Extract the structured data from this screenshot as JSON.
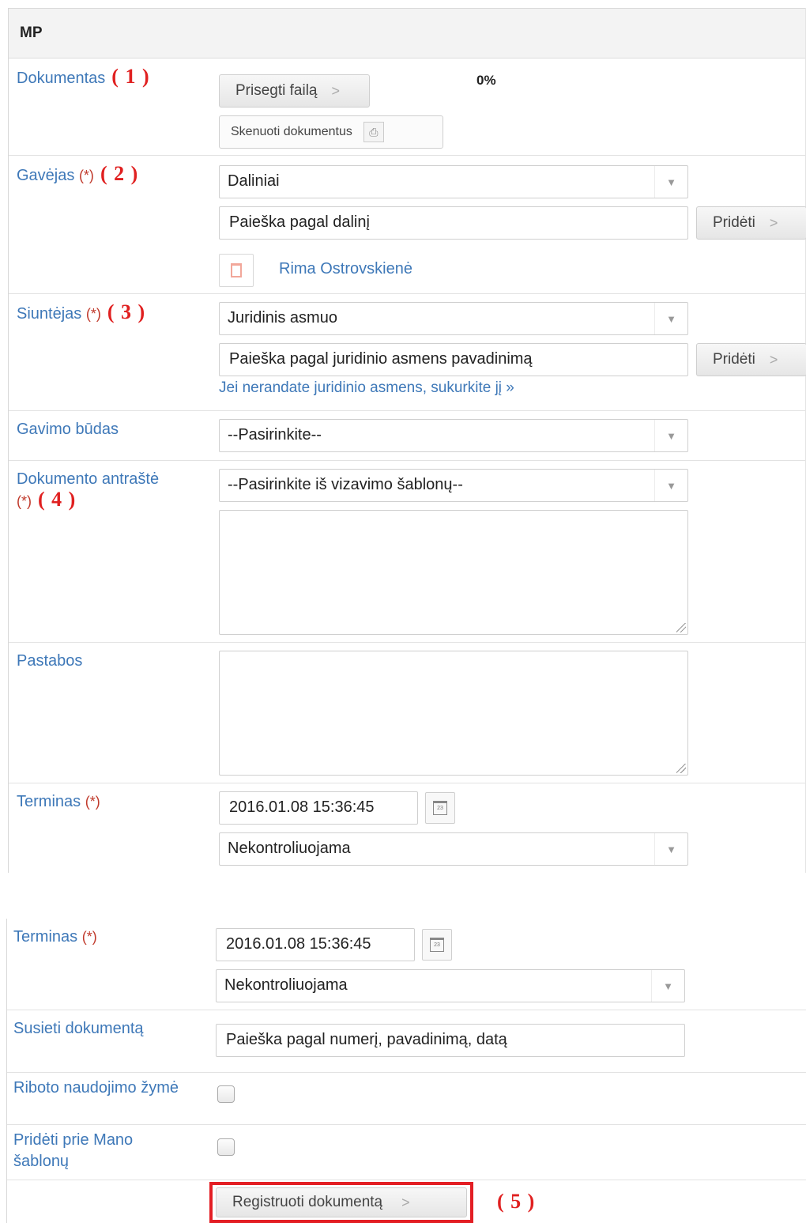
{
  "panel_title": "MP",
  "annotations": {
    "a1": "( 1 )",
    "a2": "( 2 )",
    "a3": "( 3 )",
    "a4": "( 4 )",
    "a5": "( 5 )"
  },
  "required_mark": "(*)",
  "dokumentas": {
    "label": "Dokumentas",
    "attach_button": "Prisegti failą",
    "scan_button": "Skenuoti dokumentus",
    "progress": "0%"
  },
  "gavejas": {
    "label": "Gavėjas",
    "type_select": "Daliniai",
    "search_value": "Paieška pagal dalinį",
    "add_button": "Pridėti",
    "selected_person": "Rima Ostrovskienė"
  },
  "siuntejas": {
    "label": "Siuntėjas",
    "type_select": "Juridinis asmuo",
    "search_value": "Paieška pagal juridinio asmens pavadinimą",
    "add_button": "Pridėti",
    "create_link": "Jei nerandate juridinio asmens, sukurkite jį »"
  },
  "gavimo_budas": {
    "label": "Gavimo būdas",
    "select": "--Pasirinkite--"
  },
  "antraste": {
    "label": "Dokumento antraštė",
    "select": "--Pasirinkite iš vizavimo šablonų--"
  },
  "pastabos": {
    "label": "Pastabos"
  },
  "terminas": {
    "label": "Terminas",
    "datetime": "2016.01.08 15:36:45",
    "control_select": "Nekontroliuojama"
  },
  "susieti": {
    "label": "Susieti dokumentą",
    "search_value": "Paieška pagal numerį, pavadinimą, datą"
  },
  "riboto": {
    "label": "Riboto naudojimo žymė",
    "checked": false
  },
  "prideti_sablonu": {
    "label": "Pridėti prie Mano šablonų",
    "checked": false
  },
  "submit_button": "Registruoti dokumentą",
  "colors": {
    "label_blue": "#3e78b8",
    "annotation_red": "#e02020",
    "highlight_red": "#e31e24"
  }
}
